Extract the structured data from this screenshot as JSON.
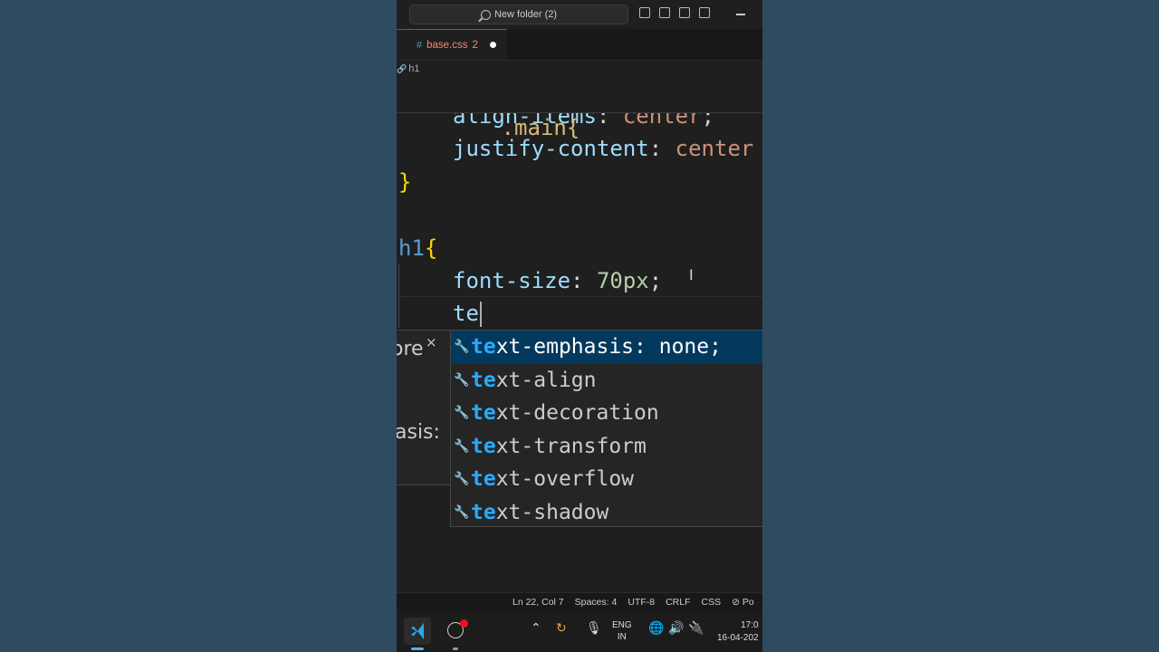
{
  "window": {
    "search_text": "New folder (2)"
  },
  "tab": {
    "hash": "#",
    "filename": "base.css",
    "problems": "2"
  },
  "breadcrumb": {
    "item": "h1"
  },
  "editor": {
    "sticky_line": ".main{",
    "lines": {
      "l1_prop": "align-items",
      "l1_val": "center",
      "l2_prop": "justify-content",
      "l2_val": "center",
      "l3_brace": "}",
      "l4_tag": "h1",
      "l4_brace": "{",
      "l5_prop": "font-size",
      "l5_val": "70px",
      "l6_typed": "te"
    }
  },
  "hover": {
    "text1": "ore",
    "text2": "asis:",
    "close": "×"
  },
  "suggestions": {
    "match": "te",
    "items": [
      {
        "rest": "xt-emphasis: none;"
      },
      {
        "rest": "xt-align"
      },
      {
        "rest": "xt-decoration"
      },
      {
        "rest": "xt-transform"
      },
      {
        "rest": "xt-overflow"
      },
      {
        "rest": "xt-shadow"
      }
    ]
  },
  "statusbar": {
    "position": "Ln 22, Col 7",
    "spaces": "Spaces: 4",
    "encoding": "UTF-8",
    "eol": "CRLF",
    "language": "CSS",
    "extra": "Po"
  },
  "taskbar": {
    "lang_top": "ENG",
    "lang_bottom": "IN",
    "time": "17:0",
    "date": "16-04-202"
  },
  "colors": {
    "accent": "#0078d4",
    "selection": "#04395e",
    "match": "#2aaaff"
  }
}
